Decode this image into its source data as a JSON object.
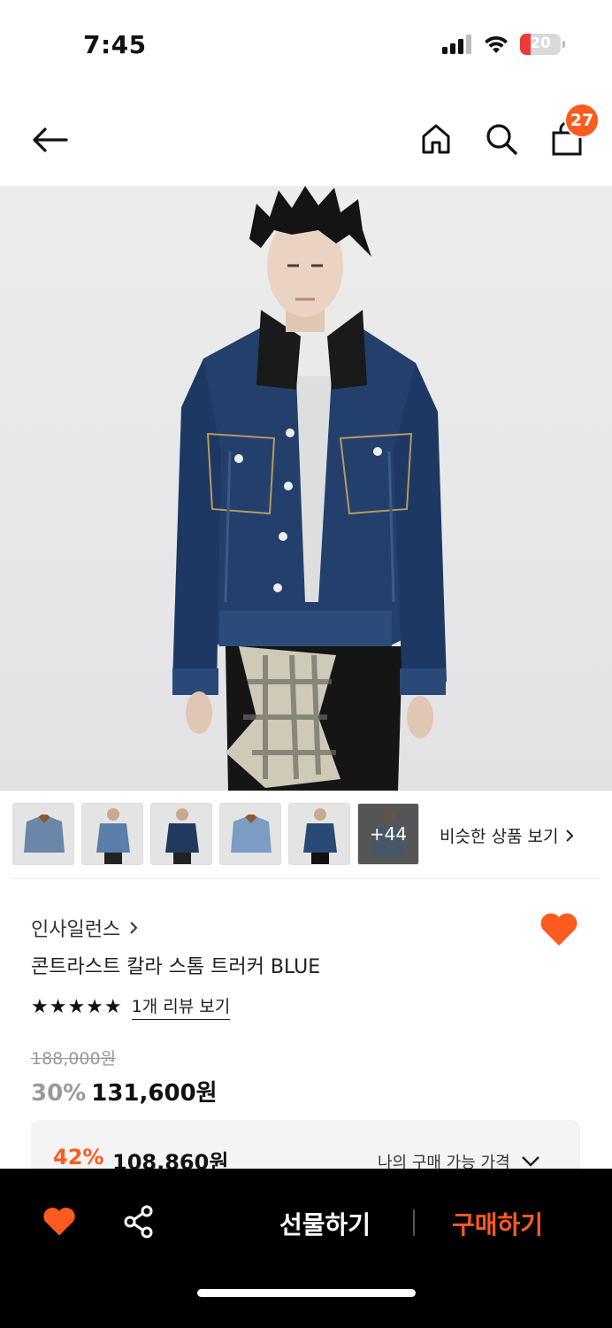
{
  "status_bar": {
    "time": "7:45",
    "battery": "20"
  },
  "header": {
    "cart_count": "27"
  },
  "thumbnails": {
    "more_label": "+44",
    "similar_label": "비슷한 상품 보기"
  },
  "product": {
    "brand": "인사일런스",
    "title": "콘트라스트 칼라 스톰 트러커 BLUE",
    "stars": "★★★★★",
    "review_link": "1개 리뷰 보기",
    "original_price": "188,000원",
    "discount": "30%",
    "price": "131,600원",
    "my_discount": "42%",
    "my_price": "108,860원",
    "my_price_label": "나의 구매 가능 가격"
  },
  "bottom_bar": {
    "gift_label": "선물하기",
    "buy_label": "구매하기"
  },
  "colors": {
    "accent": "#ff5a1f",
    "denim": "#1f3c6b"
  }
}
